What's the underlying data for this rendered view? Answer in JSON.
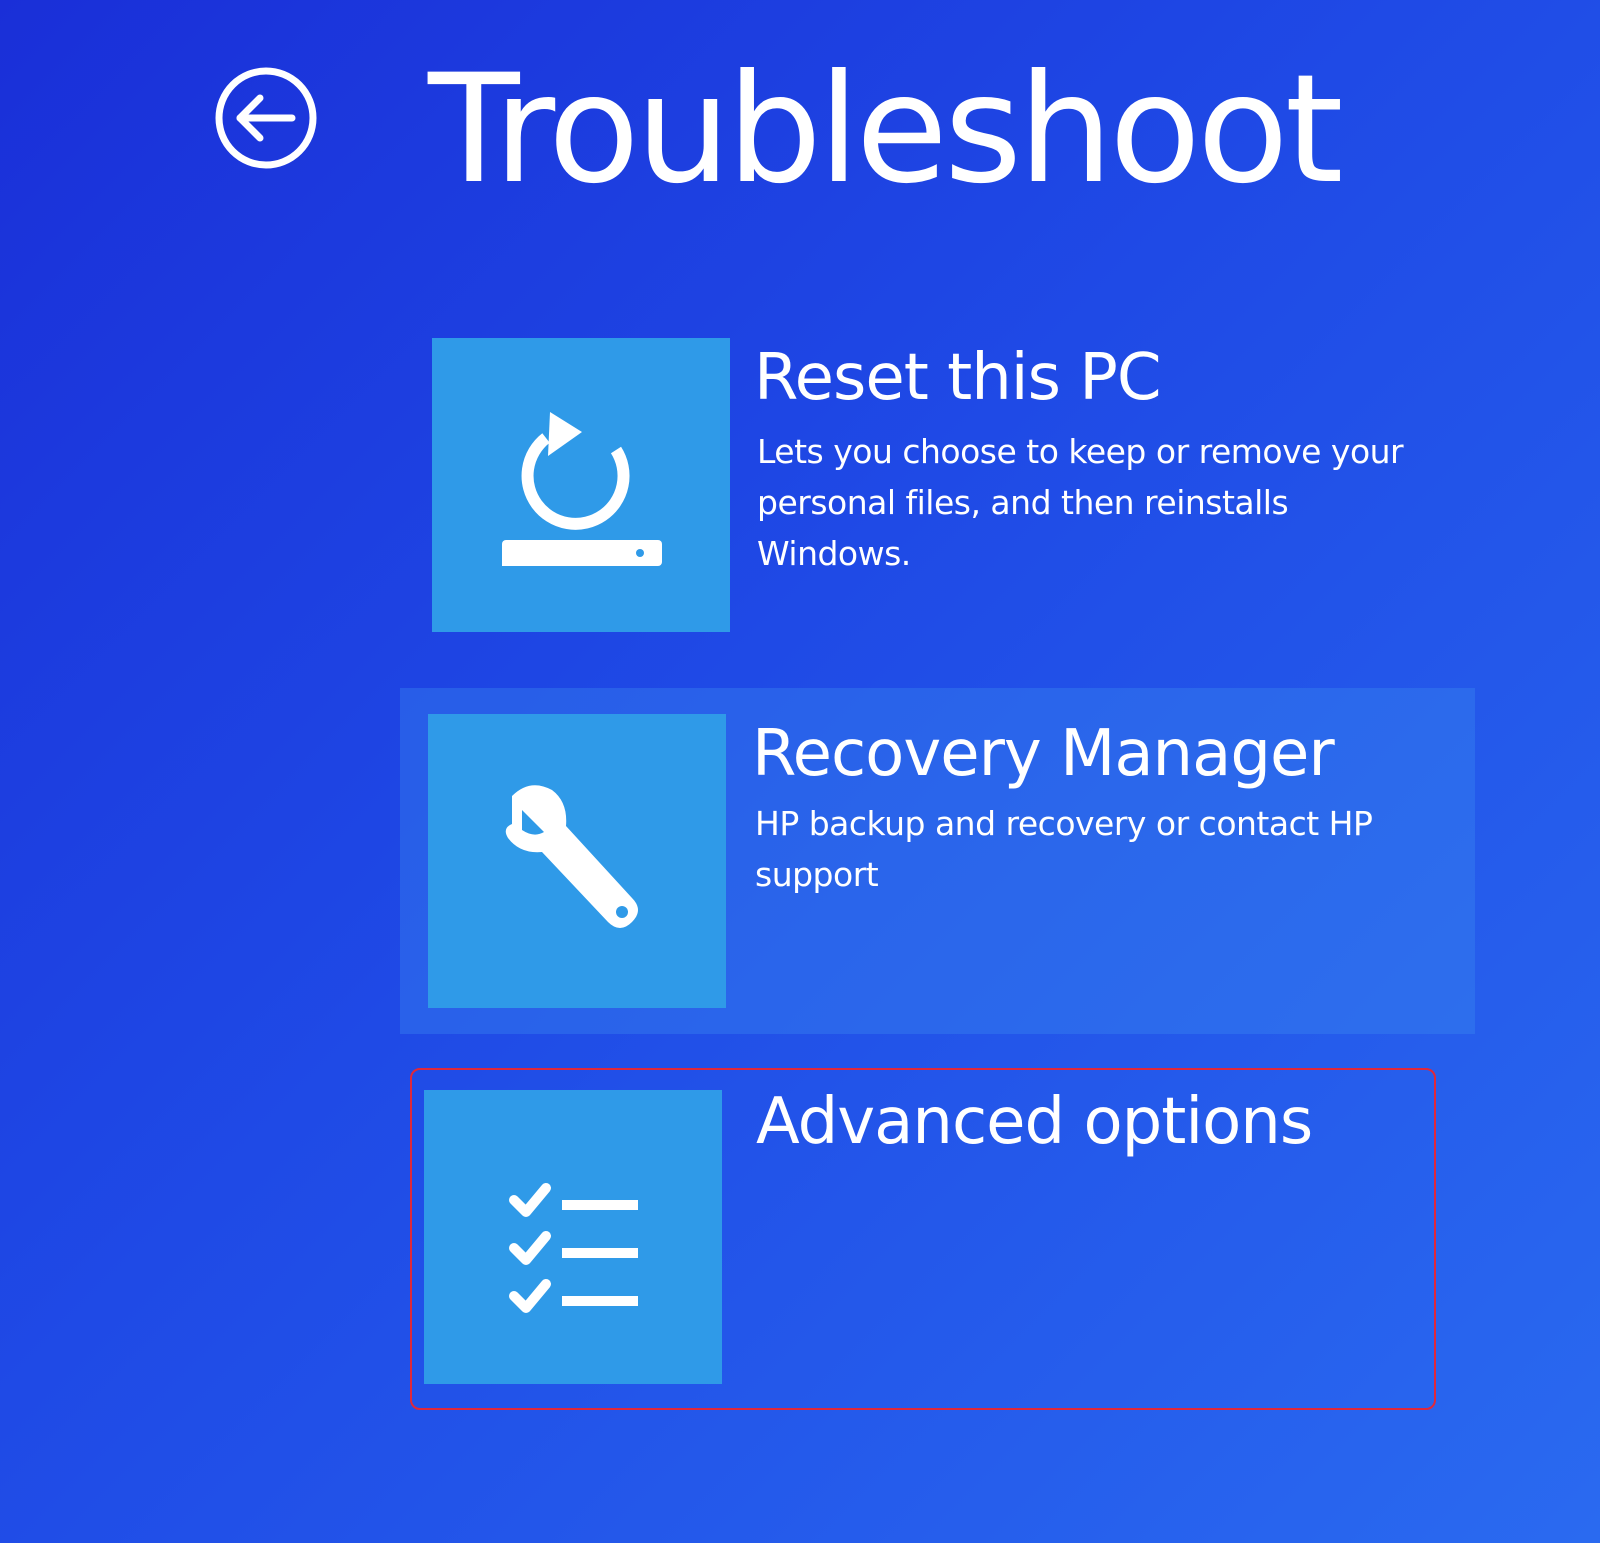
{
  "header": {
    "back_icon": "back-arrow-circle-icon",
    "title": "Troubleshoot"
  },
  "options": [
    {
      "icon": "reset-pc-icon",
      "title": "Reset this PC",
      "description": "Lets you choose to keep or remove your personal files, and then reinstalls Windows."
    },
    {
      "icon": "wrench-icon",
      "title": "Recovery Manager",
      "description": "HP backup and recovery or contact HP support"
    },
    {
      "icon": "checklist-icon",
      "title": "Advanced options",
      "description": "",
      "highlighted": true
    }
  ],
  "colors": {
    "background": "#1f4ae6",
    "tile": "#2f9ae8",
    "text": "#ffffff",
    "highlight_border": "#e0283a"
  }
}
